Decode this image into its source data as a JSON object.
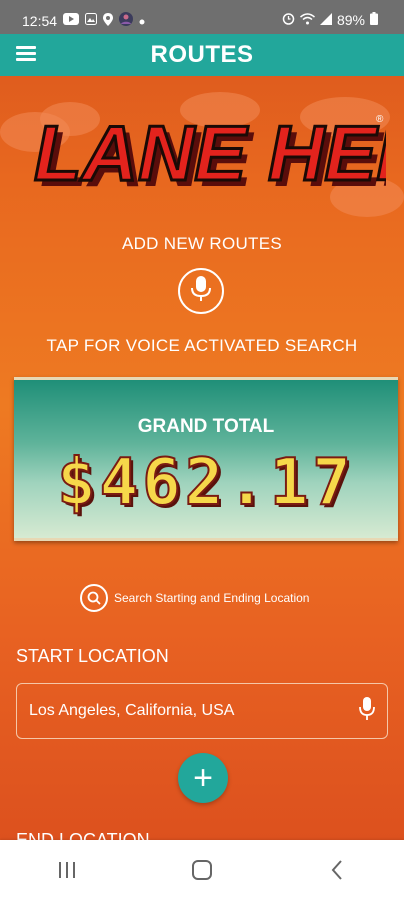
{
  "status_bar": {
    "time": "12:54",
    "battery": "89%",
    "left_icons": [
      "youtube-icon",
      "image-icon",
      "location-icon",
      "avatar-icon",
      "dot-icon"
    ],
    "right_icons": [
      "alarm-icon",
      "wifi-icon",
      "signal-icon",
      "battery-icon"
    ]
  },
  "app_bar": {
    "title": "ROUTES"
  },
  "logo": {
    "text": "LANE HERO",
    "trademark": "®"
  },
  "add_routes_label": "ADD NEW ROUTES",
  "voice_search_label": "TAP FOR VOICE ACTIVATED SEARCH",
  "total": {
    "label": "GRAND TOTAL",
    "amount": "$462.17"
  },
  "search_link": "Search Starting and Ending Location",
  "start": {
    "label": "START LOCATION",
    "value": "Los Angeles, California, USA"
  },
  "end": {
    "label": "END LOCATION"
  },
  "colors": {
    "primary": "#22a79b",
    "background": "#e8681f",
    "amount": "#f6d84a"
  }
}
